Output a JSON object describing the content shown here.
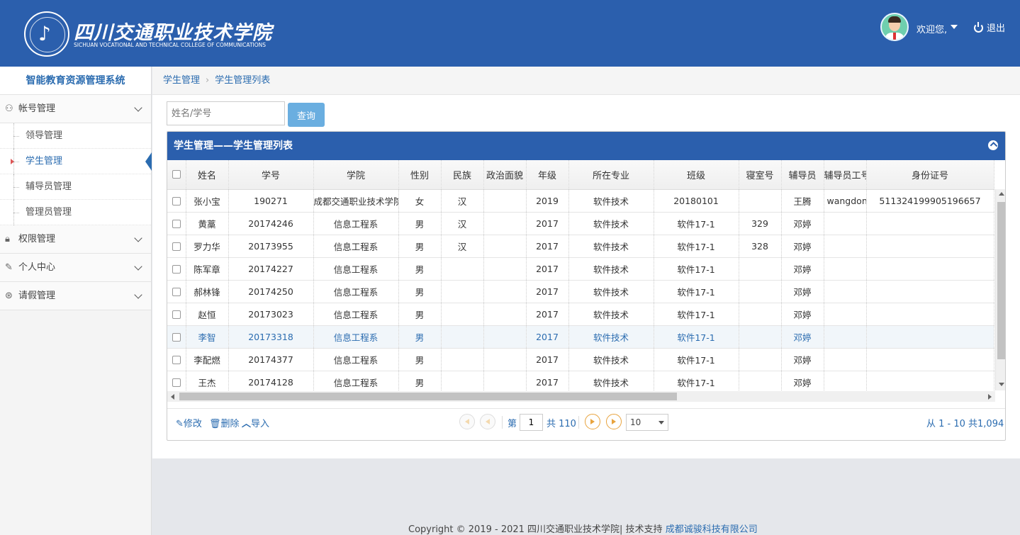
{
  "header": {
    "logo_cn": "四川交通职业技术学院",
    "logo_en": "SICHUAN VOCATIONAL AND TECHNICAL COLLEGE OF COMMUNICATIONS",
    "welcome": "欢迎您,",
    "logout": "退出"
  },
  "sidebar": {
    "title": "智能教育资源管理系统",
    "menus": [
      {
        "label": "帐号管理",
        "icon": "user-icon",
        "expanded": true,
        "items": [
          "领导管理",
          "学生管理",
          "辅导员管理",
          "管理员管理"
        ]
      },
      {
        "label": "权限管理",
        "icon": "lock-icon"
      },
      {
        "label": "个人中心",
        "icon": "pencil-icon"
      },
      {
        "label": "请假管理",
        "icon": "leave-icon"
      }
    ],
    "active_item": "学生管理"
  },
  "breadcrumb": [
    "学生管理",
    "学生管理列表"
  ],
  "search": {
    "placeholder": "姓名/学号",
    "button": "查询"
  },
  "panel": {
    "title": "学生管理——学生管理列表"
  },
  "table": {
    "columns": [
      "姓名",
      "学号",
      "学院",
      "性别",
      "民族",
      "政治面貌",
      "年级",
      "所在专业",
      "班级",
      "寝室号",
      "辅导员",
      "辅导员工号",
      "身份证号"
    ],
    "rows": [
      [
        "张小宝",
        "190271",
        "成都交通职业技术学院",
        "女",
        "汉",
        "",
        "2019",
        "软件技术",
        "20180101",
        "",
        "王腾",
        "wangdong",
        "511324199905196657"
      ],
      [
        "黄藁",
        "20174246",
        "信息工程系",
        "男",
        "汉",
        "",
        "2017",
        "软件技术",
        "软件17-1",
        "329",
        "邓婷",
        "",
        ""
      ],
      [
        "罗力华",
        "20173955",
        "信息工程系",
        "男",
        "汉",
        "",
        "2017",
        "软件技术",
        "软件17-1",
        "328",
        "邓婷",
        "",
        ""
      ],
      [
        "陈军章",
        "20174227",
        "信息工程系",
        "男",
        "",
        "",
        "2017",
        "软件技术",
        "软件17-1",
        "",
        "邓婷",
        "",
        ""
      ],
      [
        "郝林锋",
        "20174250",
        "信息工程系",
        "男",
        "",
        "",
        "2017",
        "软件技术",
        "软件17-1",
        "",
        "邓婷",
        "",
        ""
      ],
      [
        "赵恒",
        "20173023",
        "信息工程系",
        "男",
        "",
        "",
        "2017",
        "软件技术",
        "软件17-1",
        "",
        "邓婷",
        "",
        ""
      ],
      [
        "李智",
        "20173318",
        "信息工程系",
        "男",
        "",
        "",
        "2017",
        "软件技术",
        "软件17-1",
        "",
        "邓婷",
        "",
        ""
      ],
      [
        "李配燃",
        "20174377",
        "信息工程系",
        "男",
        "",
        "",
        "2017",
        "软件技术",
        "软件17-1",
        "",
        "邓婷",
        "",
        ""
      ],
      [
        "王杰",
        "20174128",
        "信息工程系",
        "男",
        "",
        "",
        "2017",
        "软件技术",
        "软件17-1",
        "",
        "邓婷",
        "",
        ""
      ]
    ],
    "highlighted_row": 6
  },
  "toolbar": {
    "edit": "修改",
    "delete": "删除",
    "import": "导入"
  },
  "pager": {
    "page_prefix": "第",
    "page": "1",
    "total_pages": "共 110",
    "page_size": "10",
    "info": "从 1 - 10 共1,094"
  },
  "footer": {
    "copyright": "Copyright © 2019 - 2021 四川交通职业技术学院| 技术支持 ",
    "support": "成都诚骏科技有限公司"
  },
  "colors": {
    "primary": "#2b5fad",
    "link": "#2b6cb0",
    "button": "#6aaee0"
  }
}
